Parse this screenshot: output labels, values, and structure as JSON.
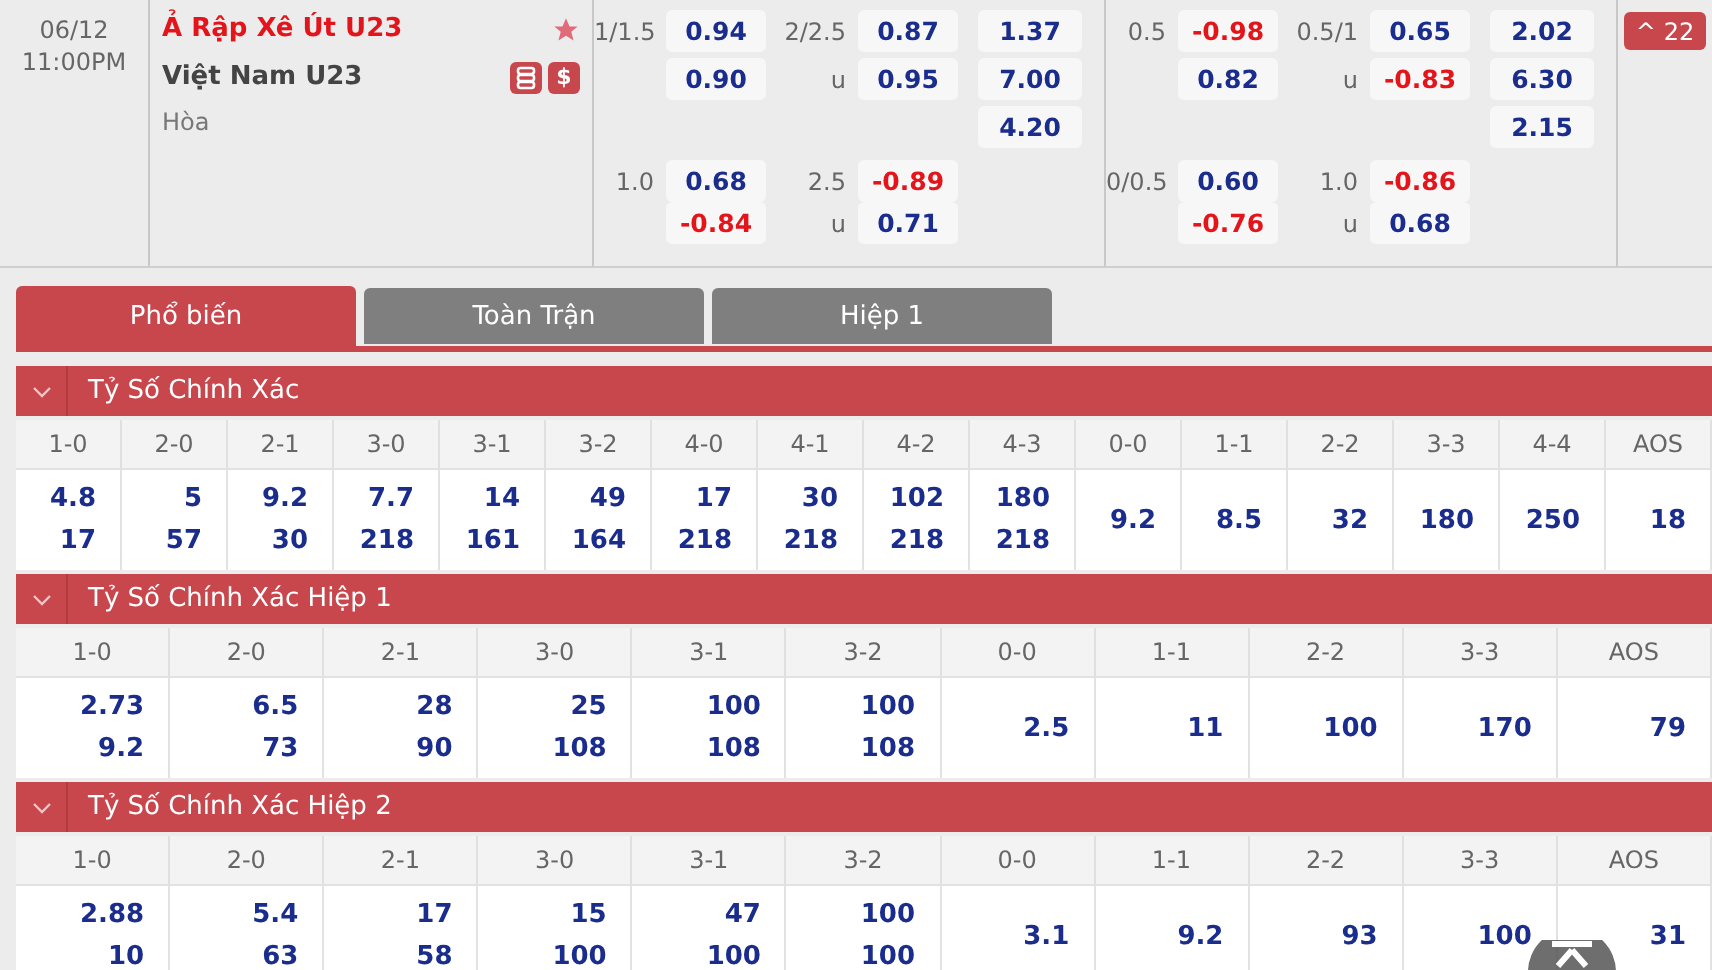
{
  "match": {
    "date": "06/12",
    "time": "11:00PM",
    "home_team": "Ả Rập Xê Út U23",
    "away_team": "Việt Nam U23",
    "draw_label": "Hòa",
    "favorite": true,
    "money_icon": "$",
    "groups": [
      {
        "lines": [
          {
            "handicap_line": "1/1.5",
            "home": {
              "text": "0.94",
              "negative": false
            },
            "away": {
              "text": "0.90",
              "negative": false
            },
            "total_line": "2/2.5",
            "over": {
              "text": "0.87",
              "negative": false
            },
            "under_label": "u",
            "under": {
              "text": "0.95",
              "negative": false
            }
          },
          {
            "handicap_line": "1.0",
            "home": {
              "text": "0.68",
              "negative": false
            },
            "away": {
              "text": "-0.84",
              "negative": true
            },
            "total_line": "2.5",
            "over": {
              "text": "-0.89",
              "negative": true
            },
            "under_label": "u",
            "under": {
              "text": "0.71",
              "negative": false
            }
          }
        ],
        "one_x_two": [
          "1.37",
          "7.00",
          "4.20"
        ]
      },
      {
        "lines": [
          {
            "handicap_line": "0.5",
            "home": {
              "text": "-0.98",
              "negative": true
            },
            "away": {
              "text": "0.82",
              "negative": false
            },
            "total_line": "0.5/1",
            "over": {
              "text": "0.65",
              "negative": false
            },
            "under_label": "u",
            "under": {
              "text": "-0.83",
              "negative": true
            }
          },
          {
            "handicap_line": "0/0.5",
            "home": {
              "text": "0.60",
              "negative": false
            },
            "away": {
              "text": "-0.76",
              "negative": true
            },
            "total_line": "1.0",
            "over": {
              "text": "-0.86",
              "negative": true
            },
            "under_label": "u",
            "under": {
              "text": "0.68",
              "negative": false
            }
          }
        ],
        "one_x_two": [
          "2.02",
          "6.30",
          "2.15"
        ]
      }
    ],
    "more_button": {
      "arrow": "^",
      "count": "22"
    }
  },
  "tabs": [
    {
      "label": "Phổ biến",
      "selected": true
    },
    {
      "label": "Toàn Trận",
      "selected": false
    },
    {
      "label": "Hiệp 1",
      "selected": false
    }
  ],
  "sections": [
    {
      "title": "Tỷ Số Chính Xác",
      "expanded": true,
      "columns": [
        {
          "score": "1-0",
          "odds": [
            "4.8",
            "17"
          ]
        },
        {
          "score": "2-0",
          "odds": [
            "5",
            "57"
          ]
        },
        {
          "score": "2-1",
          "odds": [
            "9.2",
            "30"
          ]
        },
        {
          "score": "3-0",
          "odds": [
            "7.7",
            "218"
          ]
        },
        {
          "score": "3-1",
          "odds": [
            "14",
            "161"
          ]
        },
        {
          "score": "3-2",
          "odds": [
            "49",
            "164"
          ]
        },
        {
          "score": "4-0",
          "odds": [
            "17",
            "218"
          ]
        },
        {
          "score": "4-1",
          "odds": [
            "30",
            "218"
          ]
        },
        {
          "score": "4-2",
          "odds": [
            "102",
            "218"
          ]
        },
        {
          "score": "4-3",
          "odds": [
            "180",
            "218"
          ]
        },
        {
          "score": "0-0",
          "odds": [
            "9.2"
          ]
        },
        {
          "score": "1-1",
          "odds": [
            "8.5"
          ]
        },
        {
          "score": "2-2",
          "odds": [
            "32"
          ]
        },
        {
          "score": "3-3",
          "odds": [
            "180"
          ]
        },
        {
          "score": "4-4",
          "odds": [
            "250"
          ]
        },
        {
          "score": "AOS",
          "odds": [
            "18"
          ]
        }
      ]
    },
    {
      "title": "Tỷ Số Chính Xác Hiệp 1",
      "expanded": true,
      "columns": [
        {
          "score": "1-0",
          "odds": [
            "2.73",
            "9.2"
          ]
        },
        {
          "score": "2-0",
          "odds": [
            "6.5",
            "73"
          ]
        },
        {
          "score": "2-1",
          "odds": [
            "28",
            "90"
          ]
        },
        {
          "score": "3-0",
          "odds": [
            "25",
            "108"
          ]
        },
        {
          "score": "3-1",
          "odds": [
            "100",
            "108"
          ]
        },
        {
          "score": "3-2",
          "odds": [
            "100",
            "108"
          ]
        },
        {
          "score": "0-0",
          "odds": [
            "2.5"
          ]
        },
        {
          "score": "1-1",
          "odds": [
            "11"
          ]
        },
        {
          "score": "2-2",
          "odds": [
            "100"
          ]
        },
        {
          "score": "3-3",
          "odds": [
            "170"
          ]
        },
        {
          "score": "AOS",
          "odds": [
            "79"
          ]
        }
      ]
    },
    {
      "title": "Tỷ Số Chính Xác Hiệp 2",
      "expanded": true,
      "columns": [
        {
          "score": "1-0",
          "odds": [
            "2.88",
            "10"
          ]
        },
        {
          "score": "2-0",
          "odds": [
            "5.4",
            "63"
          ]
        },
        {
          "score": "2-1",
          "odds": [
            "17",
            "58"
          ]
        },
        {
          "score": "3-0",
          "odds": [
            "15",
            "100"
          ]
        },
        {
          "score": "3-1",
          "odds": [
            "47",
            "100"
          ]
        },
        {
          "score": "3-2",
          "odds": [
            "100",
            "100"
          ]
        },
        {
          "score": "0-0",
          "odds": [
            "3.1"
          ]
        },
        {
          "score": "1-1",
          "odds": [
            "9.2"
          ]
        },
        {
          "score": "2-2",
          "odds": [
            "93"
          ]
        },
        {
          "score": "3-3",
          "odds": [
            "100"
          ]
        },
        {
          "score": "AOS",
          "odds": [
            "31"
          ]
        }
      ]
    }
  ]
}
